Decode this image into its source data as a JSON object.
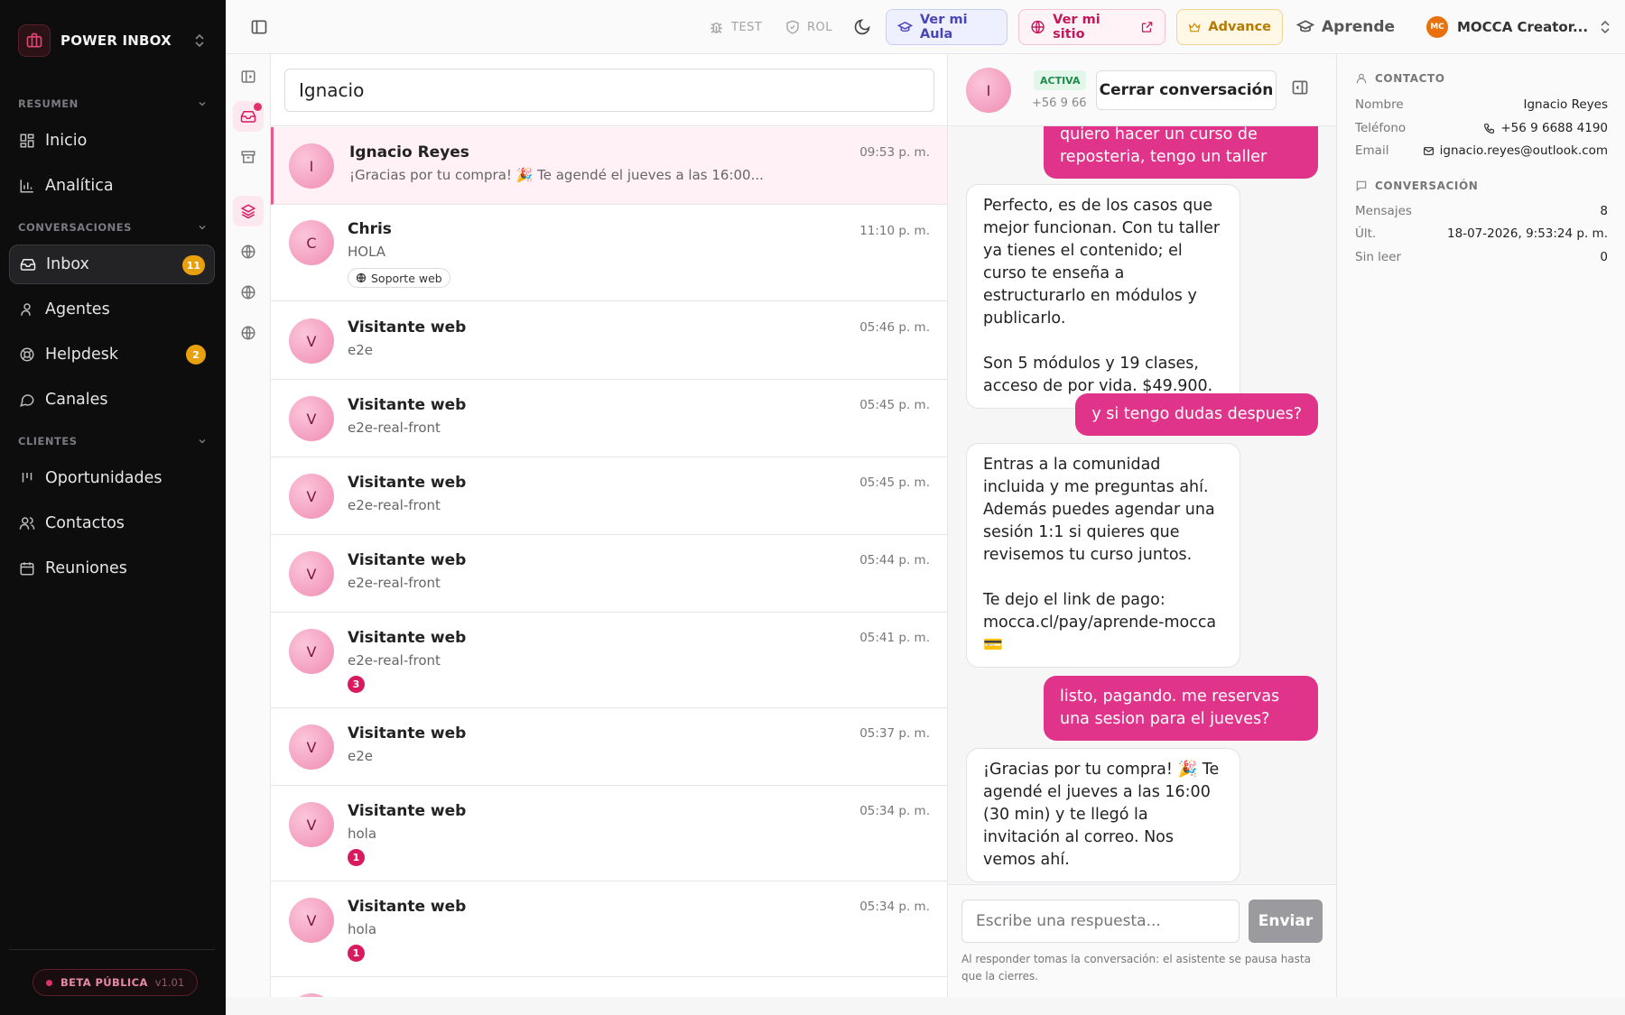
{
  "app": {
    "brand_name": "POWER INBOX",
    "beta_label": "BETA PÚBLICA",
    "version": "v1.01"
  },
  "sidebar": {
    "sections": [
      {
        "label": "RESUMEN"
      },
      {
        "label": "CONVERSACIONES"
      },
      {
        "label": "CLIENTES"
      }
    ],
    "items": [
      {
        "label": "Inicio",
        "icon": "grid-icon"
      },
      {
        "label": "Analítica",
        "icon": "bar-chart-icon"
      },
      {
        "label": "Inbox",
        "icon": "inbox-icon",
        "badge": "11",
        "active": true
      },
      {
        "label": "Agentes",
        "icon": "users-icon"
      },
      {
        "label": "Helpdesk",
        "icon": "lifebuoy-icon",
        "badge": "2"
      },
      {
        "label": "Canales",
        "icon": "chat-bubble-icon"
      },
      {
        "label": "Oportunidades",
        "icon": "kanban-icon"
      },
      {
        "label": "Contactos",
        "icon": "contacts-icon"
      },
      {
        "label": "Reuniones",
        "icon": "calendar-icon"
      }
    ]
  },
  "topbar": {
    "test_label": "TEST",
    "rol_label": "ROL",
    "ver_aula": "Ver mi Aula",
    "ver_sitio": "Ver mi sitio",
    "advance": "Advance",
    "aprende": "Aprende",
    "user_initials": "MC",
    "user_name": "MOCCA Creator..."
  },
  "search": {
    "value": "Ignacio"
  },
  "conversations": [
    {
      "name": "Ignacio Reyes",
      "initial": "I",
      "preview": "¡Gracias por tu compra! 🎉 Te agendé el jueves a las 16:00...",
      "time": "09:53 p. m.",
      "selected": true
    },
    {
      "name": "Chris",
      "initial": "C",
      "preview": "HOLA",
      "time": "11:10 p. m.",
      "tag": "Soporte web"
    },
    {
      "name": "Visitante web",
      "initial": "V",
      "preview": "e2e",
      "time": "05:46 p. m."
    },
    {
      "name": "Visitante web",
      "initial": "V",
      "preview": "e2e-real-front",
      "time": "05:45 p. m."
    },
    {
      "name": "Visitante web",
      "initial": "V",
      "preview": "e2e-real-front",
      "time": "05:45 p. m."
    },
    {
      "name": "Visitante web",
      "initial": "V",
      "preview": "e2e-real-front",
      "time": "05:44 p. m."
    },
    {
      "name": "Visitante web",
      "initial": "V",
      "preview": "e2e-real-front",
      "time": "05:41 p. m.",
      "unread": "3"
    },
    {
      "name": "Visitante web",
      "initial": "V",
      "preview": "e2e",
      "time": "05:37 p. m."
    },
    {
      "name": "Visitante web",
      "initial": "V",
      "preview": "hola",
      "time": "05:34 p. m.",
      "unread": "1"
    },
    {
      "name": "Visitante web",
      "initial": "V",
      "preview": "hola",
      "time": "05:34 p. m.",
      "unread": "1"
    }
  ],
  "chat": {
    "contact_initial": "I",
    "status": "ACTIVA",
    "phone_short": "+56 9 66",
    "close_label": "Cerrar conversación",
    "messages": [
      {
        "dir": "out",
        "text": "quiero hacer un curso de reposteria, tengo un taller"
      },
      {
        "dir": "in",
        "text": "Perfecto, es de los casos que mejor funcionan. Con tu taller ya tienes el contenido; el curso te enseña a estructurarlo en módulos y publicarlo.\n\nSon 5 módulos y 19 clases, acceso de por vida. $49.900."
      },
      {
        "dir": "out",
        "text": "y si tengo dudas despues?"
      },
      {
        "dir": "in",
        "text": "Entras a la comunidad incluida y me preguntas ahí. Además puedes agendar una sesión 1:1 si quieres que revisemos tu curso juntos.\n\nTe dejo el link de pago: mocca.cl/pay/aprende-mocca 💳"
      },
      {
        "dir": "out",
        "text": "listo, pagando. me reservas una sesion para el jueves?"
      },
      {
        "dir": "in",
        "text": "¡Gracias por tu compra! 🎉 Te agendé el jueves a las 16:00 (30 min) y te llegó la invitación al correo. Nos vemos ahí."
      }
    ],
    "reply_placeholder": "Escribe una respuesta...",
    "send_label": "Enviar",
    "hint": "Al responder tomas la conversación: el asistente se pausa hasta que la cierres."
  },
  "contact": {
    "heading": "CONTACTO",
    "name_key": "Nombre",
    "name": "Ignacio Reyes",
    "phone_key": "Teléfono",
    "phone": "+56 9 6688 4190",
    "email_key": "Email",
    "email": "ignacio.reyes@outlook.com"
  },
  "conversation_info": {
    "heading": "CONVERSACIÓN",
    "messages_key": "Mensajes",
    "messages": "8",
    "last_key": "Últ.",
    "last": "18-07-2026, 9:53:24 p. m.",
    "unread_key": "Sin leer",
    "unread": "0"
  },
  "colors": {
    "accent": "#e0348a",
    "sidebar_bg": "#0d0d0e",
    "badge": "#e8a10d",
    "status_green": "#1e8c4a"
  }
}
